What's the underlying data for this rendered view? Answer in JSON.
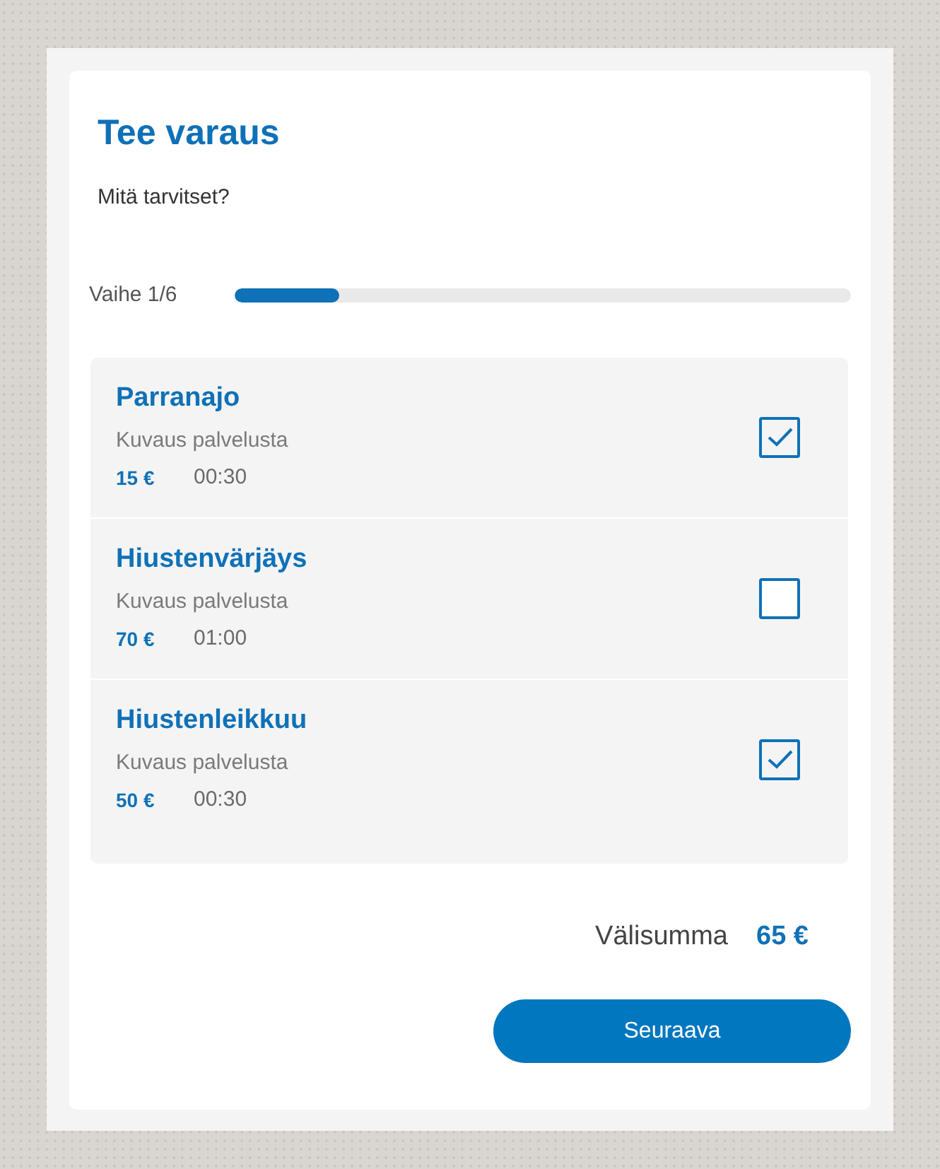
{
  "title": "Tee varaus",
  "subtitle": "Mitä tarvitset?",
  "progress": {
    "label": "Vaihe 1/6",
    "level": 0.17
  },
  "services": [
    {
      "name": "Parranajo",
      "description": "Kuvaus palvelusta",
      "price": "15 €",
      "duration": "00:30",
      "checked": true
    },
    {
      "name": "Hiustenvärjäys",
      "description": "Kuvaus palvelusta",
      "price": "70 €",
      "duration": "01:00",
      "checked": false
    },
    {
      "name": "Hiustenleikkuu",
      "description": "Kuvaus palvelusta",
      "price": "50 €",
      "duration": "00:30",
      "checked": true
    }
  ],
  "subtotal": {
    "label": "Välisumma",
    "value": "65 €"
  },
  "next_button": {
    "label": "Seuraava"
  }
}
